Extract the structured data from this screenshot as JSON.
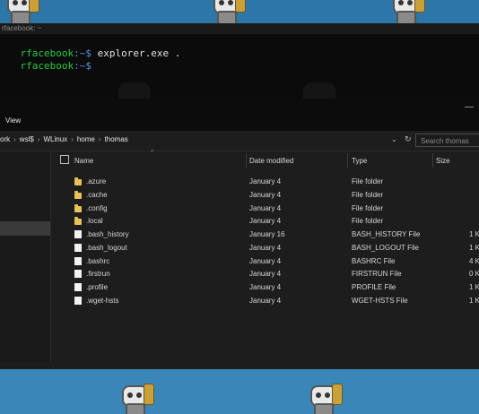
{
  "terminal": {
    "title": "rfacebook: ~",
    "line1": {
      "user": "rfacebook",
      "path": ":~$ ",
      "cmd": "explorer.exe ."
    },
    "line2": {
      "user": "rfacebook",
      "path": ":~$",
      "cmd": ""
    }
  },
  "explorer": {
    "ribbon": {
      "minimize": "—",
      "menu_view": "View"
    },
    "breadcrumb": [
      "ork",
      "wsl$",
      "WLinux",
      "home",
      "thomas"
    ],
    "search_placeholder": "Search thomas",
    "columns": {
      "name": "Name",
      "date": "Date modified",
      "type": "Type",
      "size": "Size"
    },
    "files": [
      {
        "name": ".azure",
        "date": "January 4",
        "type": "File folder",
        "size": "",
        "icon": "folder-icon"
      },
      {
        "name": ".cache",
        "date": "January 4",
        "type": "File folder",
        "size": "",
        "icon": "folder-icon"
      },
      {
        "name": ".config",
        "date": "January 4",
        "type": "File folder",
        "size": "",
        "icon": "folder-icon"
      },
      {
        "name": ".local",
        "date": "January 4",
        "type": "File folder",
        "size": "",
        "icon": "folder-icon"
      },
      {
        "name": ".bash_history",
        "date": "January 16",
        "type": "BASH_HISTORY File",
        "size": "1 K",
        "icon": "file-icon"
      },
      {
        "name": ".bash_logout",
        "date": "January 4",
        "type": "BASH_LOGOUT File",
        "size": "1 K",
        "icon": "file-icon"
      },
      {
        "name": ".bashrc",
        "date": "January 4",
        "type": "BASHRC File",
        "size": "4 K",
        "icon": "file-icon"
      },
      {
        "name": ".firstrun",
        "date": "January 4",
        "type": "FIRSTRUN File",
        "size": "0 K",
        "icon": "file-icon"
      },
      {
        "name": ".profile",
        "date": "January 4",
        "type": "PROFILE File",
        "size": "1 K",
        "icon": "file-icon"
      },
      {
        "name": ".wget-hsts",
        "date": "January 4",
        "type": "WGET-HSTS File",
        "size": "1 K",
        "icon": "file-icon"
      }
    ]
  },
  "colors": {
    "terminal_user": "#27c93f",
    "terminal_path": "#5c8fe0",
    "folder": "#e8c15a",
    "wallpaper": "#2c77a8"
  }
}
